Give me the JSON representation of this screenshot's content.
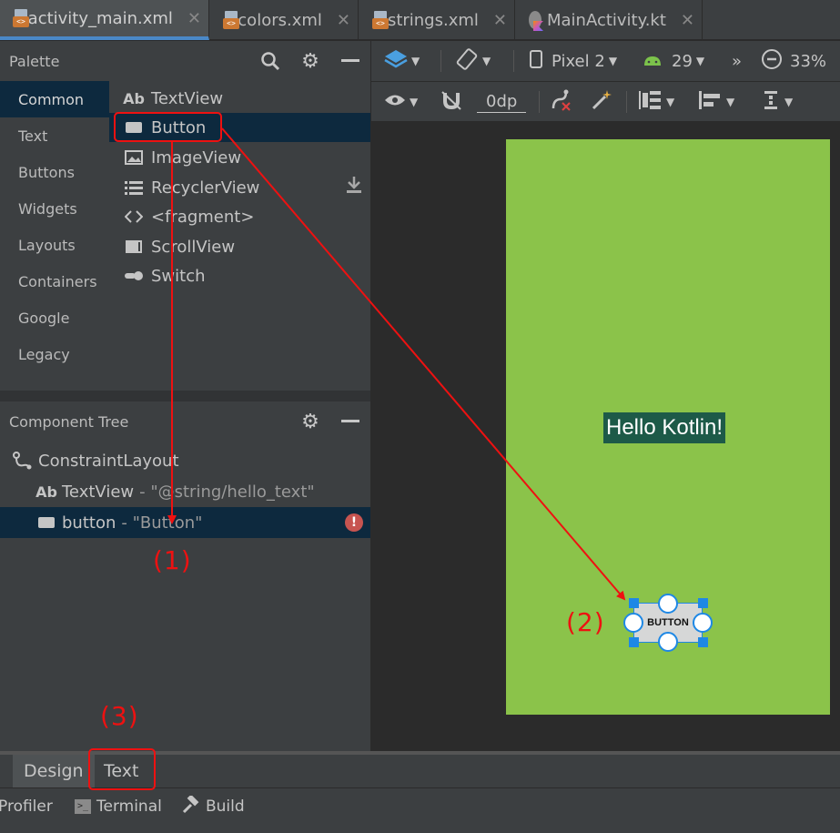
{
  "tabs": [
    {
      "label": "activity_main.xml",
      "icon": "xml-file-icon",
      "active": true
    },
    {
      "label": "colors.xml",
      "icon": "xml-file-icon",
      "active": false
    },
    {
      "label": "strings.xml",
      "icon": "xml-file-icon",
      "active": false
    },
    {
      "label": "MainActivity.kt",
      "icon": "kotlin-file-icon",
      "active": false
    }
  ],
  "close_glyph": "✕",
  "palette": {
    "title": "Palette",
    "categories": [
      "Common",
      "Text",
      "Buttons",
      "Widgets",
      "Layouts",
      "Containers",
      "Google",
      "Legacy"
    ],
    "selected_category": "Common",
    "widgets": [
      {
        "label": "TextView",
        "icon": "Ab"
      },
      {
        "label": "Button",
        "icon": "button-icon",
        "selected": true
      },
      {
        "label": "ImageView",
        "icon": "image-icon"
      },
      {
        "label": "RecyclerView",
        "icon": "list-icon"
      },
      {
        "label": "<fragment>",
        "icon": "code-icon"
      },
      {
        "label": "ScrollView",
        "icon": "scroll-icon"
      },
      {
        "label": "Switch",
        "icon": "switch-icon"
      }
    ]
  },
  "component_tree": {
    "title": "Component Tree",
    "rows": [
      {
        "label": "ConstraintLayout",
        "sub": "",
        "icon": "constraint-icon"
      },
      {
        "label": "TextView",
        "sub": "- \"@string/hello_text\"",
        "icon": "Ab"
      },
      {
        "label": "button",
        "sub": "- \"Button\"",
        "icon": "button-icon",
        "selected": true,
        "error": true
      }
    ]
  },
  "toolbar": {
    "device": "Pixel 2",
    "api": "29",
    "zoom": "33%",
    "margin": "0dp",
    "more": "»"
  },
  "preview": {
    "hello_text": "Hello Kotlin!",
    "button_text": "BUTTON",
    "background_color": "#8bc34a"
  },
  "design_tabs": [
    "Design",
    "Text"
  ],
  "active_design_tab": "Design",
  "tool_windows": [
    "Profiler",
    "Terminal",
    "Build"
  ],
  "annotations": {
    "label1": "(1)",
    "label2": "(2)",
    "label3": "(3)",
    "color": "#ee1111"
  }
}
